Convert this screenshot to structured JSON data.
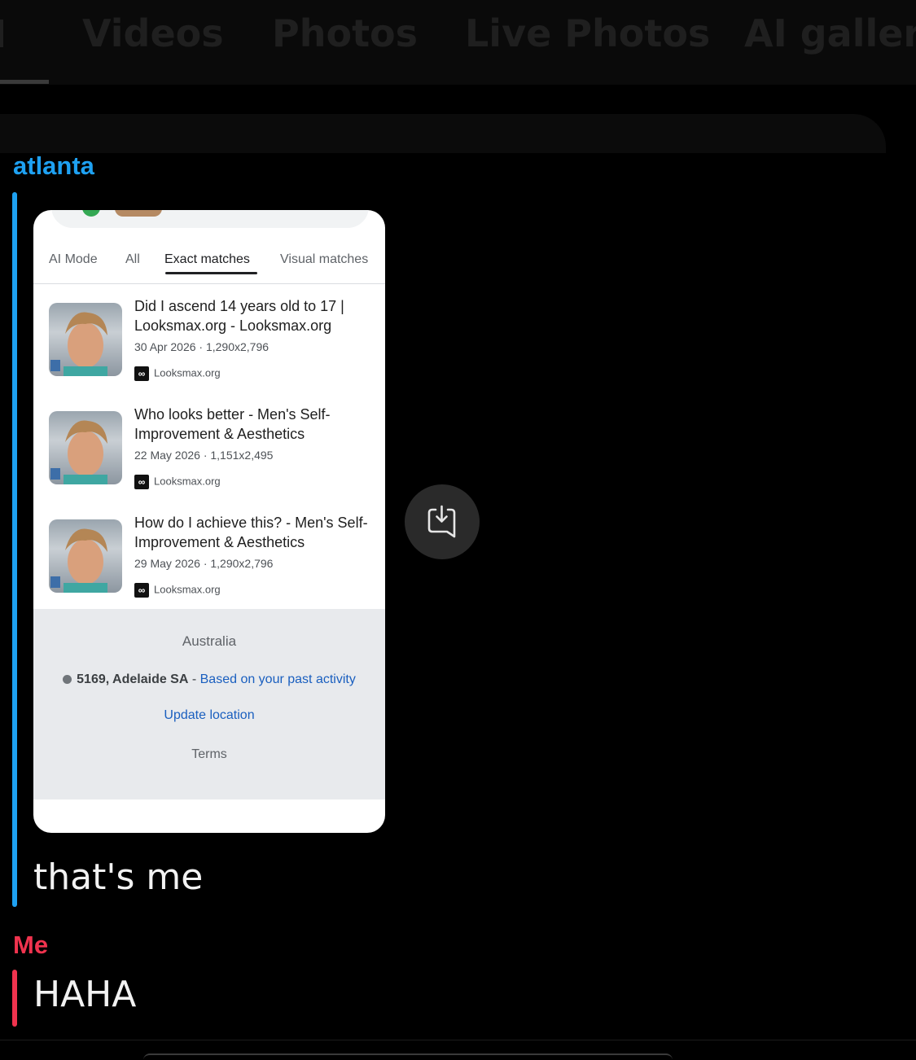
{
  "tabs": [
    "Videos",
    "Photos",
    "Live Photos",
    "AI gallery"
  ],
  "chat": {
    "messages": [
      {
        "sender": "atlanta",
        "text": "that's me"
      },
      {
        "sender": "Me",
        "text": "HAHA"
      }
    ]
  },
  "shared_image": {
    "filters": [
      "AI Mode",
      "All",
      "Exact matches",
      "Visual matches"
    ],
    "active_filter": "Exact matches",
    "results": [
      {
        "title": "Did I ascend 14 years old to 17 | Looksmax.org - Looksmax.org",
        "meta": "30 Apr 2026 · 1,290x2,796",
        "site": "Looksmax.org"
      },
      {
        "title": "Who looks better - Men's Self-Improvement & Aesthetics",
        "meta": "22 May 2026 · 1,151x2,495",
        "site": "Looksmax.org"
      },
      {
        "title": "How do I achieve this? - Men's Self-Improvement & Aesthetics",
        "meta": "29 May 2026 · 1,290x2,796",
        "site": "Looksmax.org"
      }
    ],
    "footer": {
      "country": "Australia",
      "location": "5169, Adelaide SA",
      "separator": " - ",
      "location_note": "Based on your past activity",
      "update_link": "Update location",
      "terms": "Terms"
    }
  },
  "icons": {
    "save": "save-to-device-icon",
    "site": "infinity-icon"
  },
  "colors": {
    "atlanta": "#1ea1f2",
    "me": "#f0334e",
    "link": "#1a5fbf"
  }
}
